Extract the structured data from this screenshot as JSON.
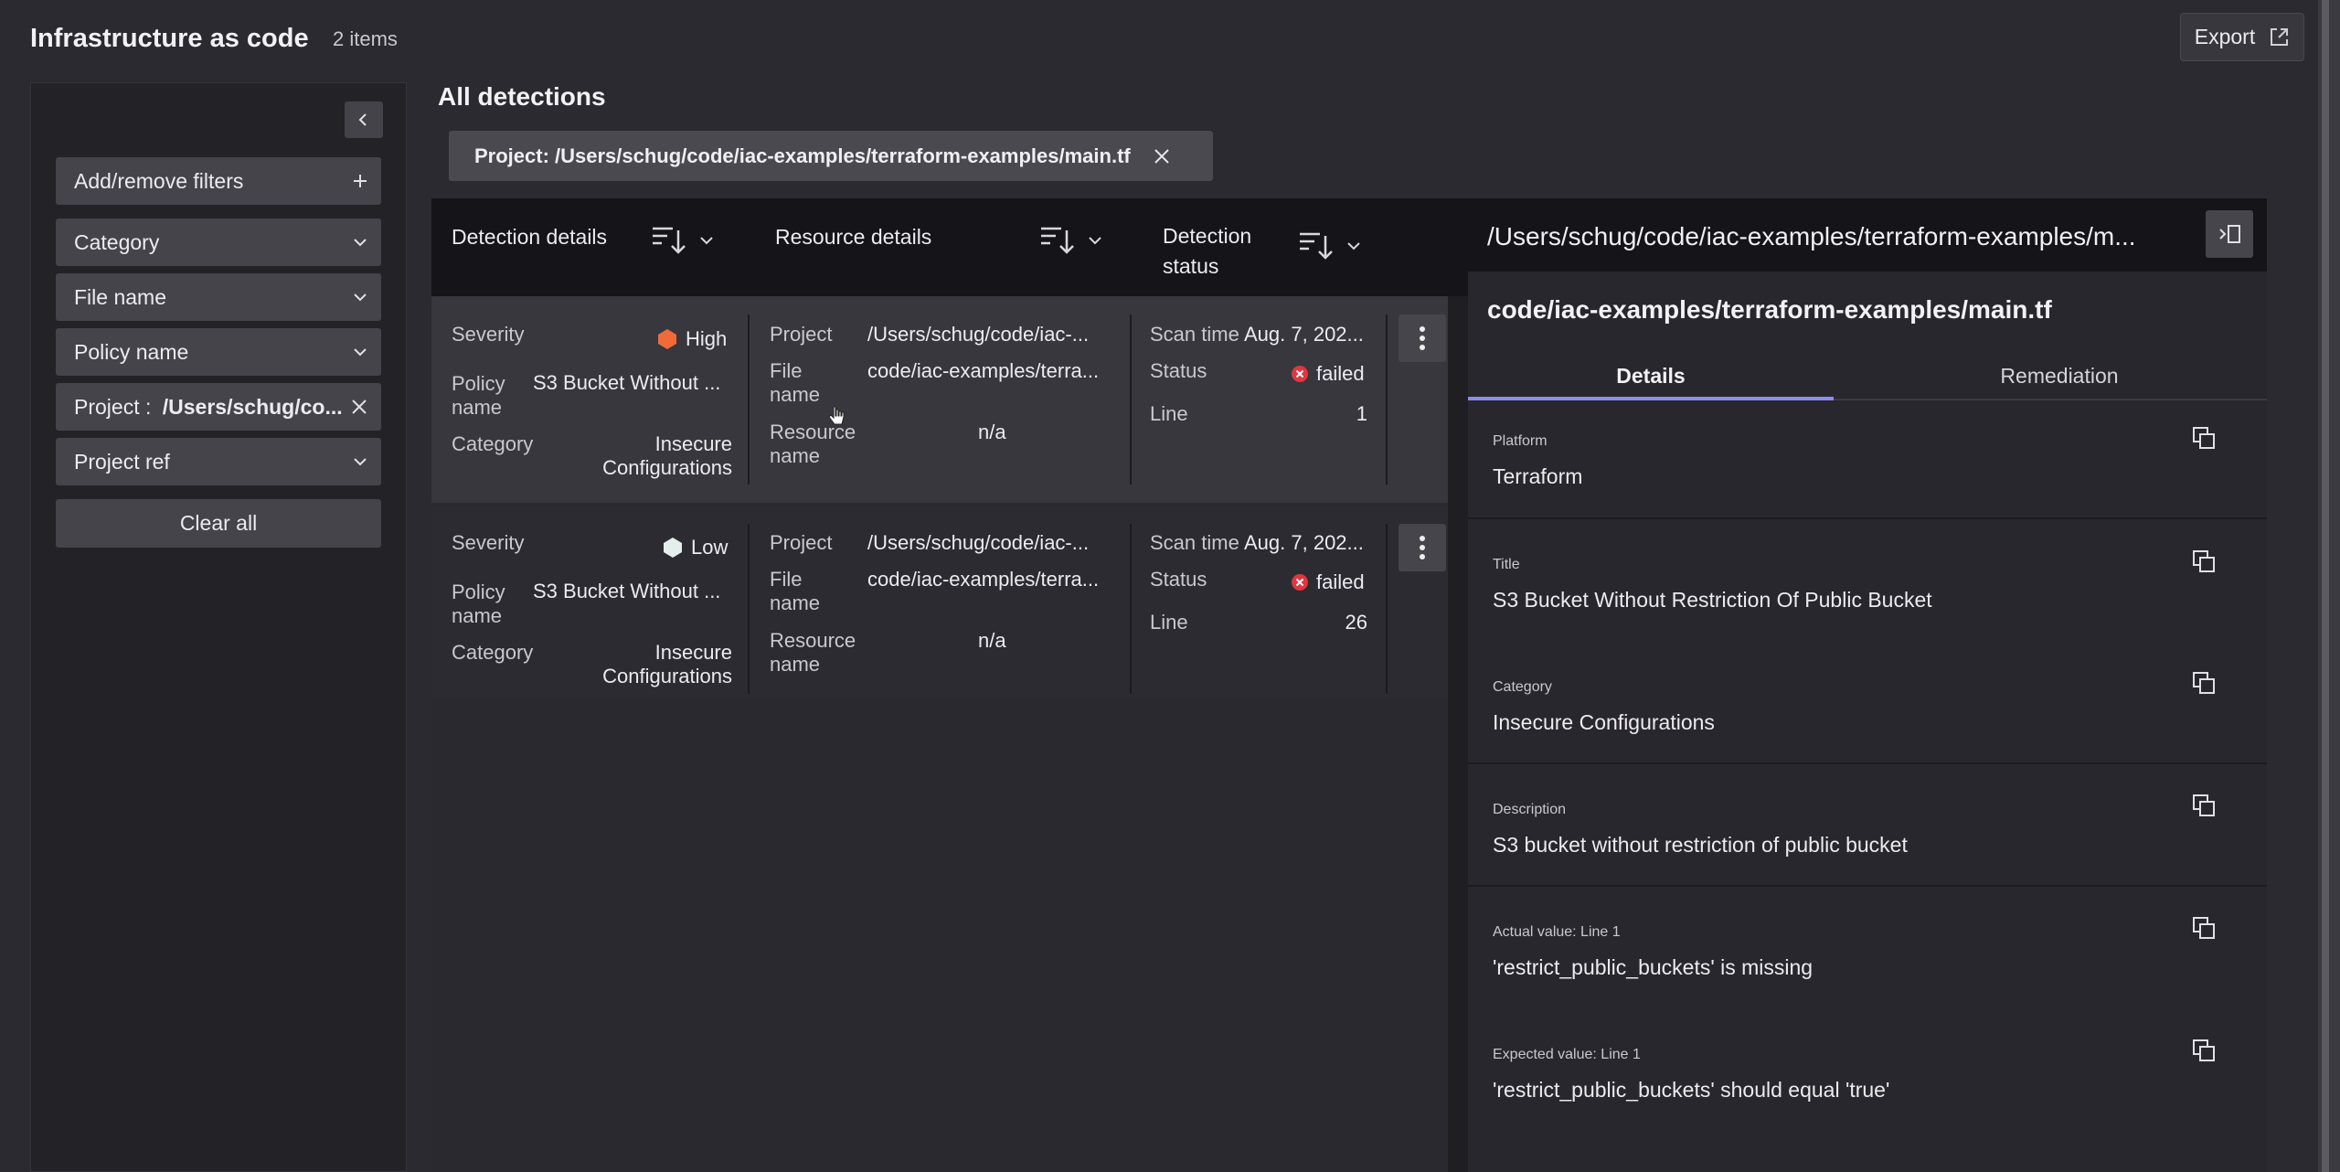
{
  "header": {
    "title": "Infrastructure as code",
    "count": "2 items",
    "export_label": "Export"
  },
  "sidebar": {
    "add_filters": "Add/remove filters",
    "filters": [
      {
        "label": "Category"
      },
      {
        "label": "File name"
      },
      {
        "label": "Policy name"
      },
      {
        "label": "Project :",
        "value": "/Users/schug/co..."
      },
      {
        "label": "Project ref"
      }
    ],
    "clear_all": "Clear all"
  },
  "main": {
    "heading": "All detections",
    "chip_label": "Project: /Users/schug/code/iac-examples/terraform-examples/main.tf"
  },
  "table": {
    "columns": [
      {
        "label": "Detection details"
      },
      {
        "label": "Resource details"
      },
      {
        "label": "Detection",
        "label2": "status"
      }
    ],
    "labels": {
      "severity": "Severity",
      "policy": "Policy",
      "policy2": "name",
      "category": "Category",
      "project": "Project",
      "file": "File",
      "file2": "name",
      "resource": "Resource",
      "resource2": "name",
      "scan_time": "Scan time",
      "status": "Status",
      "line": "Line"
    },
    "rows": [
      {
        "severity": "High",
        "severity_color": "#f06b3a",
        "policy_name": "S3 Bucket Without ...",
        "category_1": "Insecure",
        "category_2": "Configurations",
        "project": "/Users/schug/code/iac-...",
        "file_name": "code/iac-examples/terra...",
        "resource_name": "n/a",
        "scan_time": "Aug. 7, 202...",
        "status": "failed",
        "line": "1"
      },
      {
        "severity": "Low",
        "severity_color": "#e3efe8",
        "policy_name": "S3 Bucket Without ...",
        "category_1": "Insecure",
        "category_2": "Configurations",
        "project": "/Users/schug/code/iac-...",
        "file_name": "code/iac-examples/terra...",
        "resource_name": "n/a",
        "scan_time": "Aug. 7, 202...",
        "status": "failed",
        "line": "26"
      }
    ]
  },
  "panel": {
    "path": "/Users/schug/code/iac-examples/terraform-examples/m...",
    "title": "code/iac-examples/terraform-examples/main.tf",
    "tabs": [
      "Details",
      "Remediation"
    ],
    "fields": [
      {
        "label": "Platform",
        "value": "Terraform"
      },
      {
        "label": "Title",
        "value": "S3 Bucket Without Restriction Of Public Bucket"
      },
      {
        "label": "Category",
        "value": "Insecure Configurations"
      },
      {
        "label": "Description",
        "value": "S3 bucket without restriction of public bucket"
      },
      {
        "label": "Actual value: Line 1",
        "value": "'restrict_public_buckets' is missing"
      },
      {
        "label": "Expected value: Line 1",
        "value": "'restrict_public_buckets' should equal 'true'"
      }
    ]
  },
  "colors": {
    "accent": "#8a8cf0",
    "failed": "#e0363f",
    "high": "#f06b3a"
  }
}
